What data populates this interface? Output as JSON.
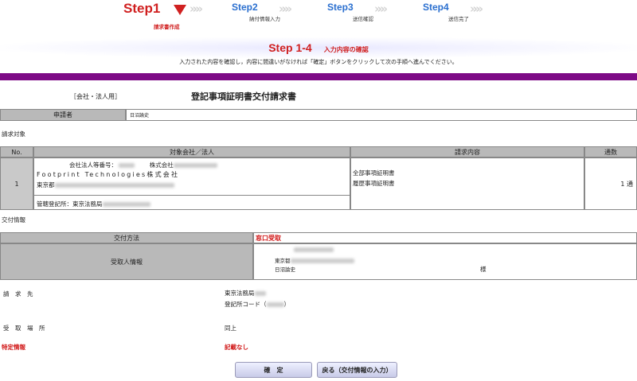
{
  "stepper": {
    "step1": {
      "label": "Step1",
      "sub": "請求書作成"
    },
    "step2": {
      "label": "Step2",
      "sub": "納付情報入力"
    },
    "step3": {
      "label": "Step3",
      "sub": "送信確認"
    },
    "step4": {
      "label": "Step4",
      "sub": "送信完了"
    }
  },
  "heading": {
    "step": "Step 1-4",
    "title": "入力内容の確認",
    "instruction": "入力された内容を確認し，内容に間違いがなければ「確定」ボタンをクリックして次の手順へ進んでください。"
  },
  "form": {
    "category": "［会社・法人用］",
    "title": "登記事項証明書交付請求書",
    "applicant_label": "申請者",
    "applicant_value": "日沼論史"
  },
  "request_section": {
    "label": "請求対象",
    "headers": {
      "no": "No.",
      "target": "対象会社／法人",
      "content": "請求内容",
      "copies": "通数"
    },
    "row": {
      "no": "1",
      "corp_number_label": "会社法人等番号：",
      "corp_prefix": "株式会社",
      "company_name": "Footprint Technologies株式会社",
      "address_prefix": "東京都",
      "registry_label": "管轄登記所：",
      "registry_value": "東京法務局",
      "contents": [
        "全部事項証明書",
        "履歴事項証明書"
      ],
      "copies": "1 通"
    }
  },
  "delivery_section": {
    "label": "交付情報",
    "method_label": "交付方法",
    "method_value": "窓口受取",
    "recipient_label": "受取人情報",
    "recipient_address_prefix": "東京都",
    "recipient_name": "日沼論史",
    "recipient_honorific": "様"
  },
  "summary": {
    "request_to_label": "請　求　先",
    "request_to_value": "東京法務局",
    "registry_code_label": "登記所コード（",
    "registry_code_close": "）",
    "pickup_label": "受　取　場　所",
    "pickup_value": "同上",
    "special_label": "特定情報",
    "special_value": "記載なし"
  },
  "buttons": {
    "confirm": "確　定",
    "back": "戻る（交付情報の入力）"
  },
  "colors": {
    "accent_red": "#d02020",
    "step_blue": "#2a6fcf",
    "banner_purple": "#7d0a86",
    "header_gray": "#b9b9b9"
  }
}
